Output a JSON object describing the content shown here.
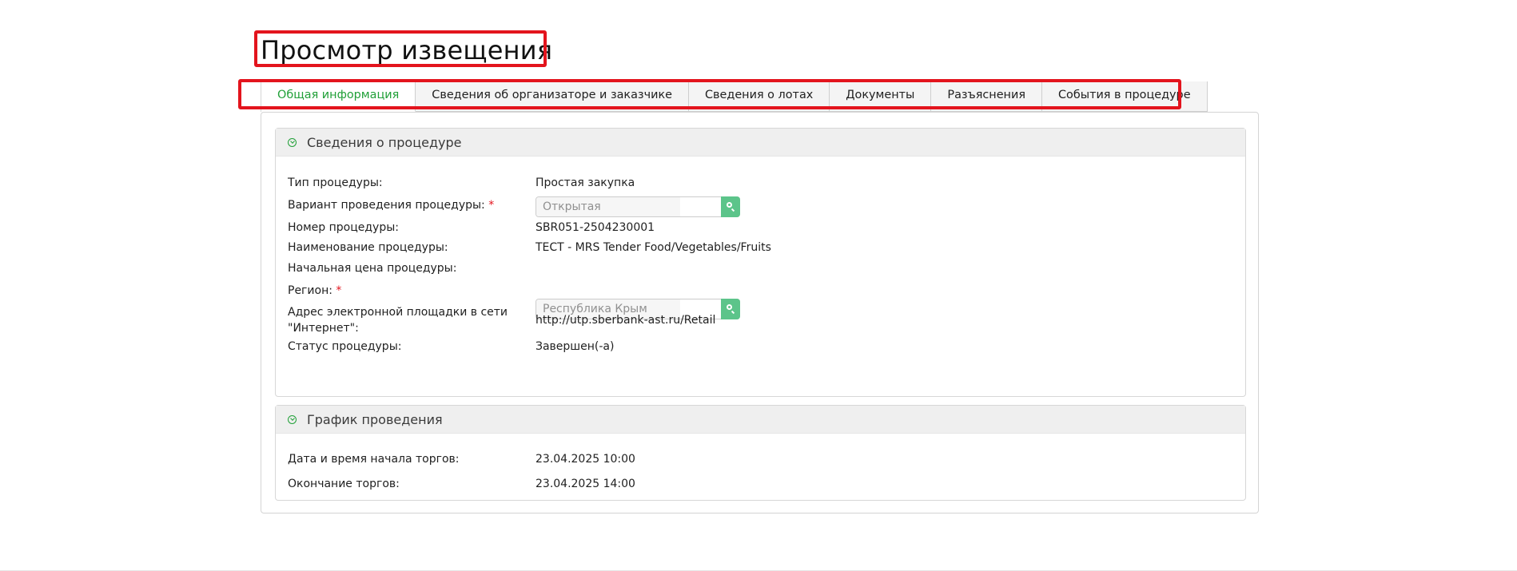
{
  "page": {
    "title": "Просмотр извещения"
  },
  "tabs": [
    {
      "label": "Общая информация",
      "active": true
    },
    {
      "label": "Сведения об организаторе и заказчике",
      "active": false
    },
    {
      "label": "Сведения о лотах",
      "active": false
    },
    {
      "label": "Документы",
      "active": false
    },
    {
      "label": "Разъяснения",
      "active": false
    },
    {
      "label": "События в процедуре",
      "active": false
    }
  ],
  "procedure": {
    "title": "Сведения о процедуре",
    "type_label": "Тип процедуры:",
    "type_value": "Простая закупка",
    "variant_label": "Вариант проведения процедуры:",
    "variant_value": "Открытая",
    "number_label": "Номер процедуры:",
    "number_value": "SBR051-2504230001",
    "name_label": "Наименование процедуры:",
    "name_value": "ТЕСТ - MRS Tender Food/Vegetables/Fruits",
    "price_label": "Начальная цена процедуры:",
    "region_label": "Регион:",
    "region_value": "Республика Крым",
    "address_label_line1": "Адрес электронной площадки в сети",
    "address_label_line2": "\"Интернет\":",
    "address_value": "http://utp.sberbank-ast.ru/Retail",
    "status_label": "Статус процедуры:",
    "status_value": "Завершен(-а)"
  },
  "schedule": {
    "title": "График проведения",
    "start_label": "Дата и время начала торгов:",
    "start_value": "23.04.2025 10:00",
    "end_label": "Окончание торгов:",
    "end_value": "23.04.2025 14:00"
  },
  "required_mark": "*",
  "colors": {
    "accent": "#21a038",
    "highlight": "#e3141d",
    "lookup_button": "#5cc48a"
  }
}
